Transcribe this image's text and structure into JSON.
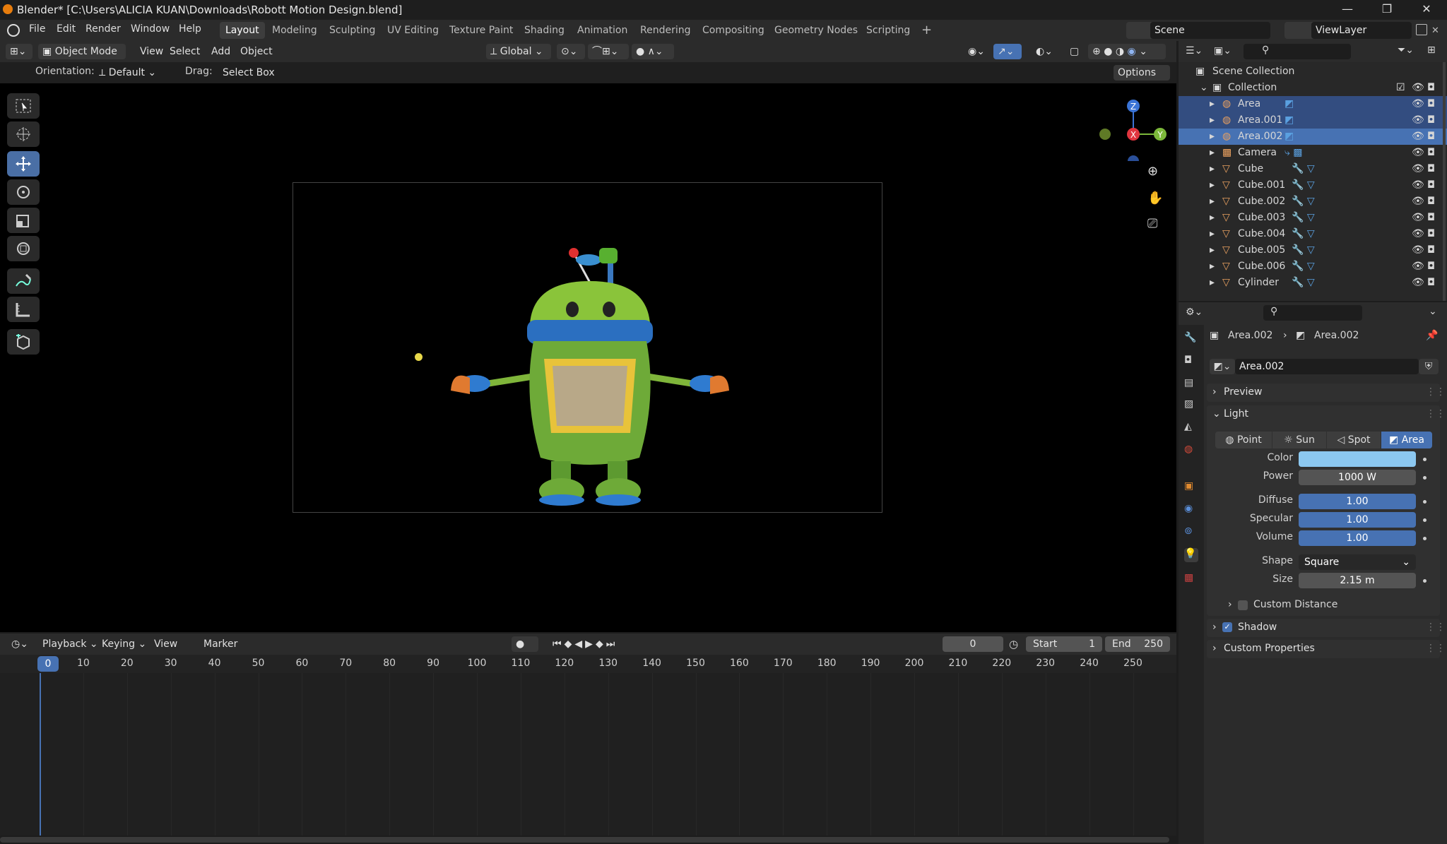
{
  "window": {
    "title": "Blender* [C:\\Users\\ALICIA KUAN\\Downloads\\Robott Motion Design.blend]",
    "minimize": "—",
    "maximize": "❐",
    "close": "✕"
  },
  "menubar": {
    "items": [
      "File",
      "Edit",
      "Render",
      "Window",
      "Help"
    ]
  },
  "workspaces": {
    "tabs": [
      "Layout",
      "Modeling",
      "Sculpting",
      "UV Editing",
      "Texture Paint",
      "Shading",
      "Animation",
      "Rendering",
      "Compositing",
      "Geometry Nodes",
      "Scripting"
    ],
    "add": "+"
  },
  "scene": {
    "name": "Scene",
    "viewlayer": "ViewLayer"
  },
  "viewport_header": {
    "mode": "Object Mode",
    "menus": [
      "View",
      "Select",
      "Add",
      "Object"
    ],
    "transform_orientation": "Global",
    "orientation_label": "Orientation:",
    "orientation_value": "Default",
    "drag_label": "Drag:",
    "drag_value": "Select Box",
    "options": "Options"
  },
  "gizmo": {
    "z": "Z",
    "x": "X",
    "y": "Y"
  },
  "timeline": {
    "menus": [
      "Playback",
      "Keying",
      "View",
      "Marker"
    ],
    "current_frame": "0",
    "start_label": "Start",
    "start_value": "1",
    "end_label": "End",
    "end_value": "250",
    "ticks": [
      "0",
      "10",
      "20",
      "30",
      "40",
      "50",
      "60",
      "70",
      "80",
      "90",
      "100",
      "110",
      "120",
      "130",
      "140",
      "150",
      "160",
      "170",
      "180",
      "190",
      "200",
      "210",
      "220",
      "230",
      "240",
      "250"
    ]
  },
  "outliner": {
    "root": "Scene Collection",
    "collection": "Collection",
    "items": [
      {
        "name": "Area",
        "type": "light"
      },
      {
        "name": "Area.001",
        "type": "light"
      },
      {
        "name": "Area.002",
        "type": "light"
      },
      {
        "name": "Camera",
        "type": "camera"
      },
      {
        "name": "Cube",
        "type": "mesh"
      },
      {
        "name": "Cube.001",
        "type": "mesh"
      },
      {
        "name": "Cube.002",
        "type": "mesh"
      },
      {
        "name": "Cube.003",
        "type": "mesh"
      },
      {
        "name": "Cube.004",
        "type": "mesh"
      },
      {
        "name": "Cube.005",
        "type": "mesh"
      },
      {
        "name": "Cube.006",
        "type": "mesh"
      },
      {
        "name": "Cylinder",
        "type": "mesh"
      }
    ]
  },
  "properties": {
    "breadcrumb_object": "Area.002",
    "breadcrumb_data": "Area.002",
    "datablock_name": "Area.002",
    "panels": {
      "preview": "Preview",
      "light": "Light",
      "custom_distance": "Custom Distance",
      "shadow": "Shadow",
      "custom_properties": "Custom Properties"
    },
    "light_types": [
      "Point",
      "Sun",
      "Spot",
      "Area"
    ],
    "active_light_type": "Area",
    "color_label": "Color",
    "color_value": "#8cc8f0",
    "power_label": "Power",
    "power_value": "1000 W",
    "diffuse_label": "Diffuse",
    "diffuse_value": "1.00",
    "specular_label": "Specular",
    "specular_value": "1.00",
    "volume_label": "Volume",
    "volume_value": "1.00",
    "shape_label": "Shape",
    "shape_value": "Square",
    "size_label": "Size",
    "size_value": "2.15 m"
  }
}
